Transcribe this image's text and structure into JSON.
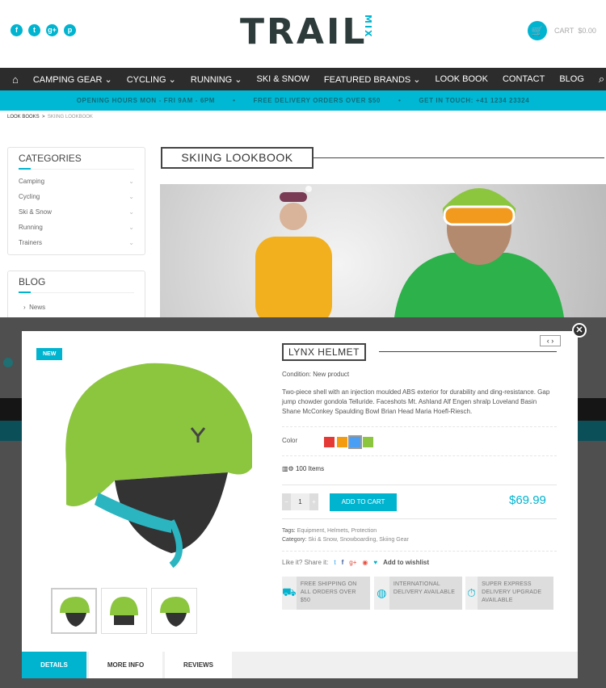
{
  "header": {
    "social": [
      {
        "icon": "facebook-icon",
        "glyph": "f"
      },
      {
        "icon": "twitter-icon",
        "glyph": "t"
      },
      {
        "icon": "google-plus-icon",
        "glyph": "g+"
      },
      {
        "icon": "pinterest-icon",
        "glyph": "p"
      }
    ],
    "logo": "TRAIL",
    "logo_sub": "MIX",
    "cart_label": "CART",
    "cart_total": "$0.00"
  },
  "nav": {
    "items": [
      "CAMPING GEAR ⌄",
      "CYCLING ⌄",
      "RUNNING ⌄",
      "SKI & SNOW",
      "FEATURED BRANDS ⌄",
      "LOOK BOOK",
      "CONTACT",
      "BLOG"
    ]
  },
  "strip": {
    "hours": "OPENING HOURS MON - FRI 9AM - 6PM",
    "delivery": "FREE DELIVERY ORDERS OVER $50",
    "contact": "GET IN TOUCH: +41 1234 23324",
    "sep": "•"
  },
  "breadcrumb": {
    "parent": "LOOK BOOKS",
    "sep": ">",
    "current": "SKIING LOOKBOOK"
  },
  "sidebar": {
    "categories_title": "CATEGORIES",
    "categories": [
      "Camping",
      "Cycling",
      "Ski & Snow",
      "Running",
      "Trainers"
    ],
    "blog_title": "BLOG",
    "blog_items": [
      "News"
    ]
  },
  "page": {
    "title": "SKIING LOOKBOOK"
  },
  "modal": {
    "badge": "NEW",
    "title": "LYNX HELMET",
    "condition": "Condition: New product",
    "description": "Two-piece shell with an injection moulded ABS exterior for durability and ding-resistance. Gap jump chowder gondola Telluride. Faceshots Mt. Ashland Alf Engen shralp Loveland Basin Shane McConkey Spaulding Bowl Brian Head Maria Hoefl-Riesch.",
    "color_label": "Color",
    "colors": [
      "#e53935",
      "#f39c12",
      "#4a9ff5",
      "#8cc63f"
    ],
    "selected_color": "#4a9ff5",
    "stock": "100 Items",
    "quantity": "1",
    "minus": "−",
    "plus": "+",
    "add_to_cart": "ADD TO CART",
    "price": "$69.99",
    "tags_label": "Tags:",
    "tags": "Equipment,  Helmets,  Protection",
    "category_label": "Category:",
    "categories": "Ski & Snow,  Snowboarding,  Skiing Gear",
    "share_label": "Like it? Share it:",
    "wishlist": "Add to wishlist",
    "features": [
      "FREE SHIPPING ON ALL ORDERS OVER $50",
      "INTERNATIONAL DELIVERY AVAILABLE",
      "SUPER EXPRESS DELIVERY UPGRADE AVAILABLE"
    ],
    "tabs": [
      "DETAILS",
      "MORE INFO",
      "REVIEWS"
    ],
    "accent": "#00b4d0",
    "helmet_color": "#8cc63f"
  }
}
